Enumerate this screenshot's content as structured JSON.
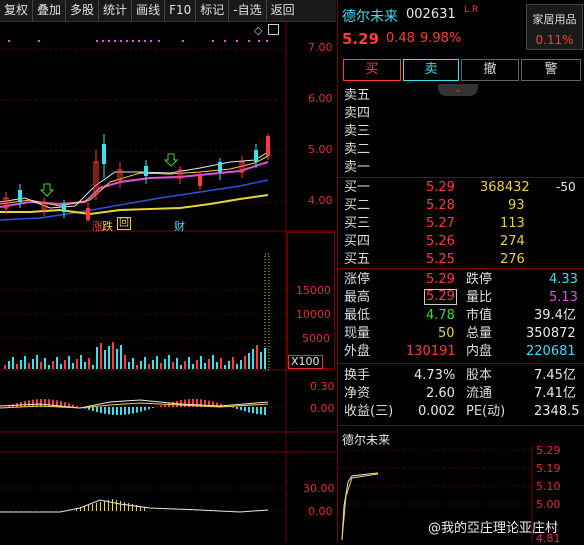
{
  "toolbar": {
    "buttons": [
      "复权",
      "叠加",
      "多股",
      "统计",
      "画线",
      "F10",
      "标记",
      "-自选",
      "返回"
    ]
  },
  "chart": {
    "price_ticks": [
      "7.00",
      "6.00",
      "5.00",
      "4.00"
    ],
    "markers": {
      "zt": "涨",
      "die": "跌",
      "hui": "回",
      "cai": "财"
    },
    "volume_ticks": [
      "15000",
      "10000",
      "5000"
    ],
    "volume_unit": "X100",
    "macd_ticks": [
      "0.30",
      "0.00"
    ],
    "ind3_ticks": [
      "30.00",
      "0.00"
    ]
  },
  "stock": {
    "name": "德尔未来",
    "code": "002631",
    "flags": "L R",
    "sector": "家居用品",
    "price": "5.29",
    "change": "0.48",
    "change_pct": "9.98%",
    "sector_pct": "0.11%"
  },
  "actions": {
    "buy": "买",
    "sell": "卖",
    "cancel": "撤",
    "alert": "警"
  },
  "order_book": {
    "asks": [
      {
        "label": "卖五",
        "price": "",
        "vol": ""
      },
      {
        "label": "卖四",
        "price": "",
        "vol": ""
      },
      {
        "label": "卖三",
        "price": "",
        "vol": ""
      },
      {
        "label": "卖二",
        "price": "",
        "vol": ""
      },
      {
        "label": "卖一",
        "price": "",
        "vol": ""
      }
    ],
    "bids": [
      {
        "label": "买一",
        "price": "5.29",
        "vol": "368432",
        "delta": "-50"
      },
      {
        "label": "买二",
        "price": "5.28",
        "vol": "93",
        "delta": ""
      },
      {
        "label": "买三",
        "price": "5.27",
        "vol": "113",
        "delta": ""
      },
      {
        "label": "买四",
        "price": "5.26",
        "vol": "274",
        "delta": ""
      },
      {
        "label": "买五",
        "price": "5.25",
        "vol": "276",
        "delta": ""
      }
    ]
  },
  "quote": {
    "limit_up_label": "涨停",
    "limit_up": "5.29",
    "limit_down_label": "跌停",
    "limit_down": "4.33",
    "high_label": "最高",
    "high": "5.29",
    "vol_ratio_label": "量比",
    "vol_ratio": "5.13",
    "low_label": "最低",
    "low": "4.78",
    "mkt_cap_label": "市值",
    "mkt_cap": "39.4亿",
    "cur_vol_label": "现量",
    "cur_vol": "50",
    "total_vol_label": "总量",
    "total_vol": "350872",
    "outer_label": "外盘",
    "outer": "130191",
    "inner_label": "内盘",
    "inner": "220681",
    "turnover_label": "换手",
    "turnover": "4.73%",
    "capital_label": "股本",
    "capital": "7.45亿",
    "nav_label": "净资",
    "nav": "2.60",
    "float_label": "流通",
    "float": "7.41亿",
    "eps_label": "收益(三)",
    "eps": "0.002",
    "pe_label": "PE(动)",
    "pe": "2348.5"
  },
  "mini_chart": {
    "title": "德尔未来",
    "ticks": [
      "5.29",
      "5.19",
      "5.10",
      "5.00",
      "4.81"
    ]
  },
  "watermark": "@我的亞庄理论亚庄村",
  "colors": {
    "up": "#ff3c3c",
    "down": "#33dd33",
    "ma5": "#e8e8e8",
    "ma10": "#e8d43a",
    "ma20": "#e050e0",
    "ma60": "#3050e0",
    "bg": "#000000"
  }
}
